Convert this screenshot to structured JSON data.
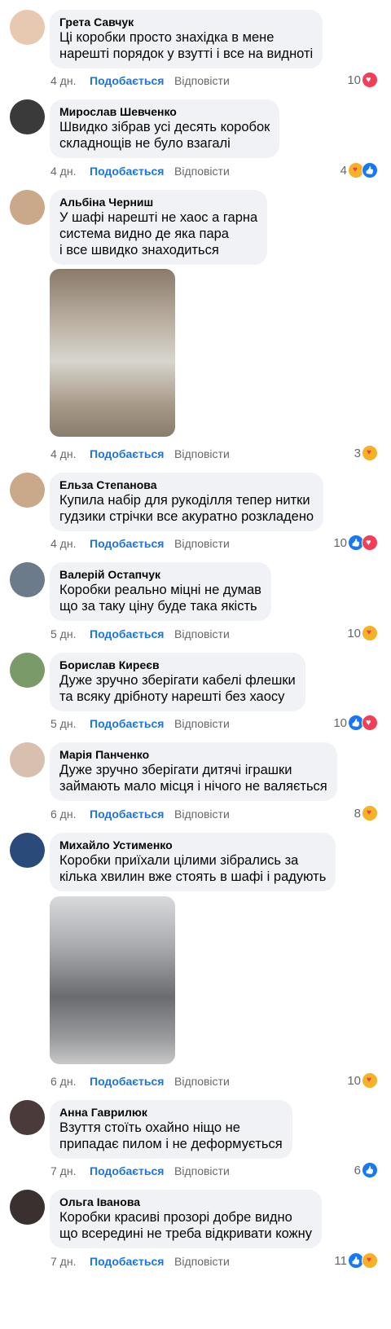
{
  "comments": [
    {
      "name": "Грета Савчук",
      "text": "Ці коробки просто знахідка в мене\nнарешті порядок у взутті і все на видноті",
      "time": "4 дн.",
      "like": "Подобається",
      "reply": "Відповісти",
      "count": "10",
      "reactions": [
        "heart"
      ],
      "avatar_color": "#e6c9b0"
    },
    {
      "name": "Мирослав Шевченко",
      "text": "Швидко зібрав усі десять коробок\nскладнощів не було взагалі",
      "time": "4 дн.",
      "like": "Подобається",
      "reply": "Відповісти",
      "count": "4",
      "reactions": [
        "care",
        "like"
      ],
      "avatar_color": "#3a3a3a"
    },
    {
      "name": "Альбіна Черниш",
      "text": "У шафі нарешті не хаос а гарна\nсистема видно де яка пара\nі все швидко знаходиться",
      "time": "4 дн.",
      "like": "Подобається",
      "reply": "Відповісти",
      "count": "3",
      "reactions": [
        "care"
      ],
      "avatar_color": "#c9a98a",
      "photo": "boxes-in-room-photo"
    },
    {
      "name": "Ельза Степанова",
      "text": "Купила набір для рукоділля тепер нитки\nгудзики стрічки все акуратно розкладено",
      "time": "4 дн.",
      "like": "Подобається",
      "reply": "Відповісти",
      "count": "10",
      "reactions": [
        "like",
        "heart"
      ],
      "avatar_color": "#c9a98a"
    },
    {
      "name": "Валерій Остапчук",
      "text": "Коробки реально міцні не думав\nщо за таку ціну буде така якість",
      "time": "5 дн.",
      "like": "Подобається",
      "reply": "Відповісти",
      "count": "10",
      "reactions": [
        "care"
      ],
      "avatar_color": "#6b7b8a"
    },
    {
      "name": "Борислав Киреєв",
      "text": "Дуже зручно зберігати кабелі флешки\nта всяку дрібноту нарешті без хаосу",
      "time": "5 дн.",
      "like": "Подобається",
      "reply": "Відповісти",
      "count": "10",
      "reactions": [
        "like",
        "heart"
      ],
      "avatar_color": "#7a9a6a"
    },
    {
      "name": "Марія Панченко",
      "text": "Дуже зручно зберігати дитячі іграшки\nзаймають мало місця і нічого не валяється",
      "time": "6 дн.",
      "like": "Подобається",
      "reply": "Відповісти",
      "count": "8",
      "reactions": [
        "care"
      ],
      "avatar_color": "#d8c0b0"
    },
    {
      "name": "Михайло Устименко",
      "text": "Коробки приїхали цілими зібрались за\nкілька хвилин вже стоять в шафі і радують",
      "time": "6 дн.",
      "like": "Подобається",
      "reply": "Відповісти",
      "count": "10",
      "reactions": [
        "care"
      ],
      "avatar_color": "#2a4a7a",
      "photo": "stacked-shoe-boxes-photo"
    },
    {
      "name": "Анна Гаврилюк",
      "text": "Взуття стоїть охайно ніщо не\nприпадає пилом і не деформується",
      "time": "7 дн.",
      "like": "Подобається",
      "reply": "Відповісти",
      "count": "6",
      "reactions": [
        "like"
      ],
      "avatar_color": "#4a3a3a"
    },
    {
      "name": "Ольга Іванова",
      "text": "Коробки красиві прозорі добре видно\nщо всередині не треба відкривати кожну",
      "time": "7 дн.",
      "like": "Подобається",
      "reply": "Відповісти",
      "count": "11",
      "reactions": [
        "like",
        "care"
      ],
      "avatar_color": "#3a3030"
    }
  ]
}
